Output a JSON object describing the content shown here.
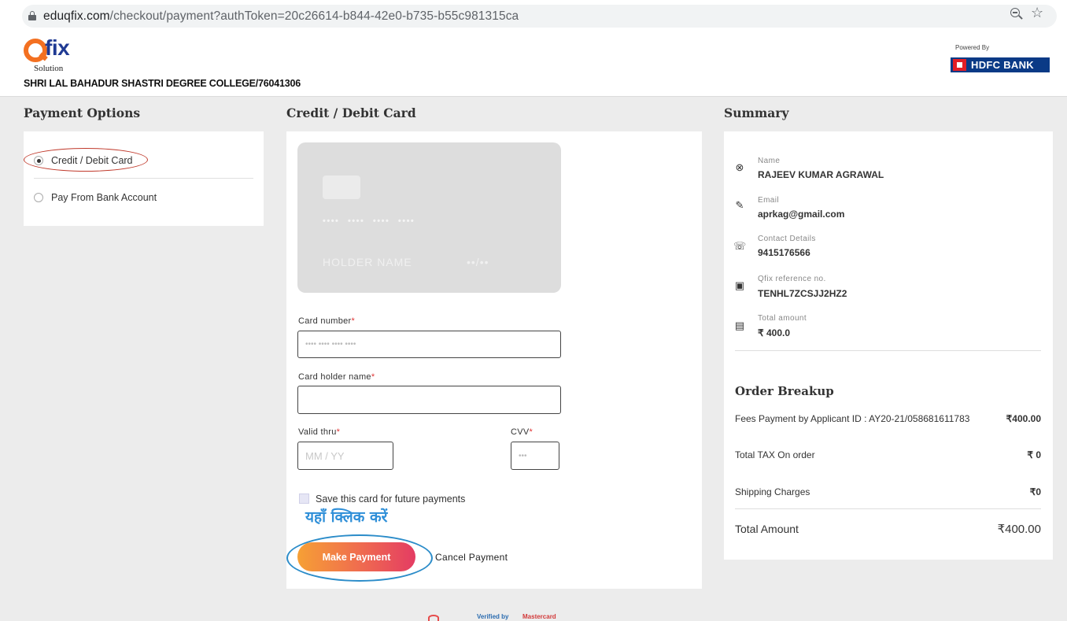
{
  "browser": {
    "url_host": "eduqfix.com",
    "url_path": "/checkout/payment?authToken=20c26614-b844-42e0-b735-b55c981315ca",
    "icons": [
      "lock-icon",
      "zoom-out-icon",
      "bookmark-star-icon"
    ]
  },
  "header": {
    "logo_fix": "fix",
    "logo_solution": "Solution",
    "college": "SHRI LAL BAHADUR SHASTRI DEGREE COLLEGE/76041306",
    "powered_by": "Powered By",
    "bank": "HDFC BANK"
  },
  "sections": {
    "payment_options": "Payment Options",
    "card": "Credit / Debit Card",
    "summary": "Summary"
  },
  "payment_options": [
    {
      "label": "Credit / Debit Card",
      "selected": true
    },
    {
      "label": "Pay From Bank Account",
      "selected": false
    }
  ],
  "card_preview": {
    "number": "•••• •••• •••• ••••",
    "holder": "HOLDER NAME",
    "expiry": "••/••"
  },
  "form": {
    "card_number_label": "Card number",
    "card_number_placeholder": "•••• •••• •••• ••••",
    "holder_label": "Card holder name",
    "holder_value": "",
    "valid_label": "Valid thru",
    "valid_placeholder": "MM / YY",
    "cvv_label": "CVV",
    "cvv_placeholder": "•••",
    "required_mark": "*",
    "save_card_label": "Save this card for future payments",
    "save_card_checked": false,
    "hindi_note": "यहाँ क्लिक करें",
    "make_payment": "Make Payment",
    "cancel_payment": "Cancel Payment"
  },
  "summary": {
    "name_label": "Name",
    "name_value": "RAJEEV KUMAR AGRAWAL",
    "email_label": "Email",
    "email_value": "aprkag@gmail.com",
    "contact_label": "Contact Details",
    "contact_value": "9415176566",
    "ref_label": "Qfix reference no.",
    "ref_value": "TENHL7ZCSJJ2HZ2",
    "amount_label": "Total amount",
    "amount_value": "₹ 400.0"
  },
  "order": {
    "title": "Order Breakup",
    "rows": [
      {
        "label": "Fees Payment by Applicant ID : AY20-21/058681611783",
        "value": "₹400.00"
      },
      {
        "label": "Total TAX On order",
        "value": "₹ 0"
      },
      {
        "label": "Shipping Charges",
        "value": "₹0"
      }
    ],
    "total_label": "Total Amount",
    "total_value": "₹400.00"
  },
  "footer": {
    "verified": "Verified by",
    "mastercard": "Mastercard"
  },
  "colors": {
    "brand_orange": "#f37021",
    "brand_blue": "#1f3a93",
    "hdfc_blue": "#0a3a86",
    "button_gradient_start": "#f6a035",
    "button_gradient_end": "#e43c63",
    "annotation_red": "#c0392b",
    "annotation_blue": "#2b8cc9"
  }
}
